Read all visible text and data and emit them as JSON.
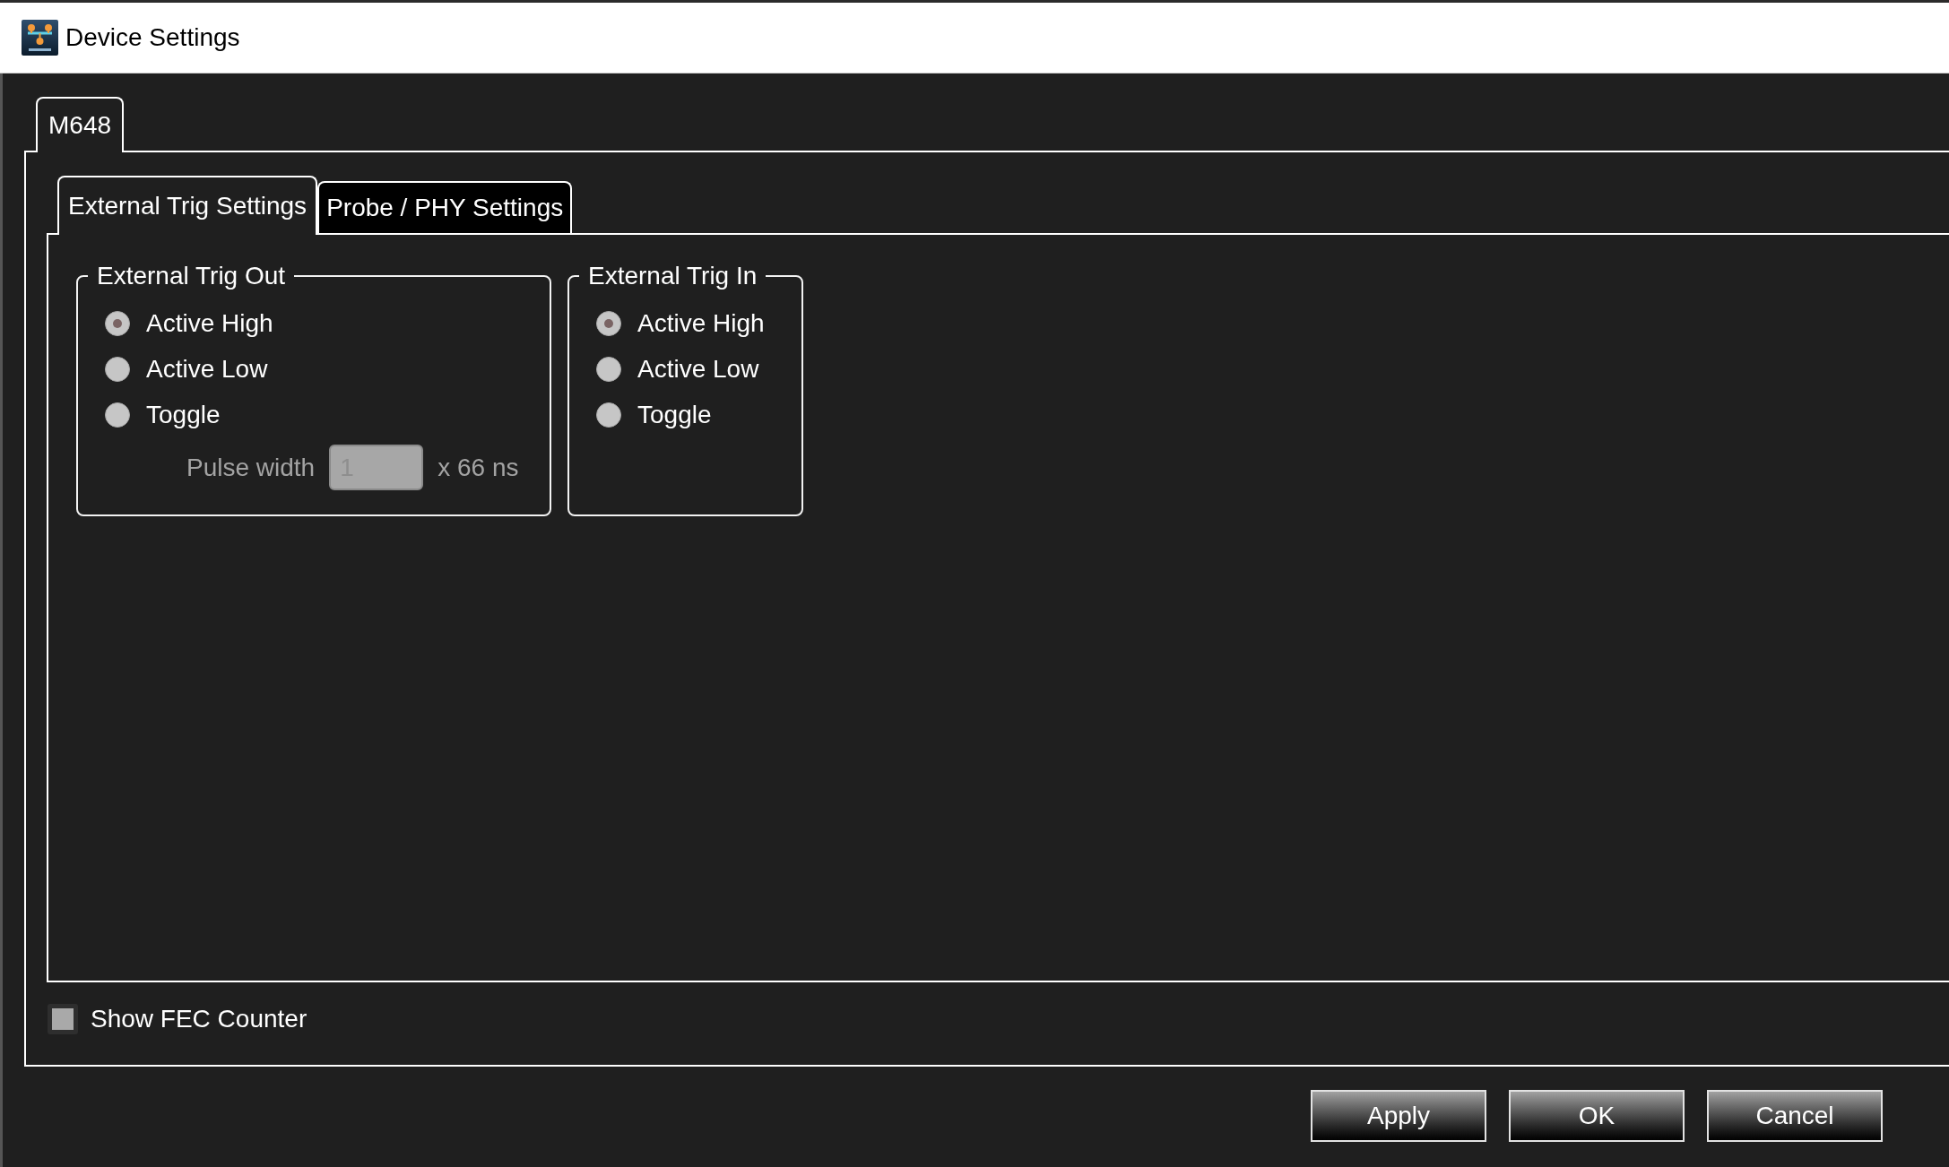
{
  "window": {
    "title": "Device Settings"
  },
  "device_tabs": [
    {
      "label": "M648",
      "selected": true
    }
  ],
  "settings_tabs": [
    {
      "label": "External Trig Settings",
      "selected": true
    },
    {
      "label": "Probe / PHY Settings",
      "selected": false
    }
  ],
  "groups": [
    {
      "title": "External Trig Out",
      "options": [
        {
          "label": "Active High",
          "selected": true
        },
        {
          "label": "Active Low",
          "selected": false
        },
        {
          "label": "Toggle",
          "selected": false
        }
      ],
      "pulse_width": {
        "label": "Pulse width",
        "value": "1",
        "unit": "x 66 ns",
        "disabled": true
      }
    },
    {
      "title": "External Trig In",
      "options": [
        {
          "label": "Active High",
          "selected": true
        },
        {
          "label": "Active Low",
          "selected": false
        },
        {
          "label": "Toggle",
          "selected": false
        }
      ]
    }
  ],
  "show_fec_counter": {
    "label": "Show FEC Counter",
    "checked": false
  },
  "buttons": [
    {
      "label": "Apply"
    },
    {
      "label": "OK"
    },
    {
      "label": "Cancel"
    }
  ]
}
